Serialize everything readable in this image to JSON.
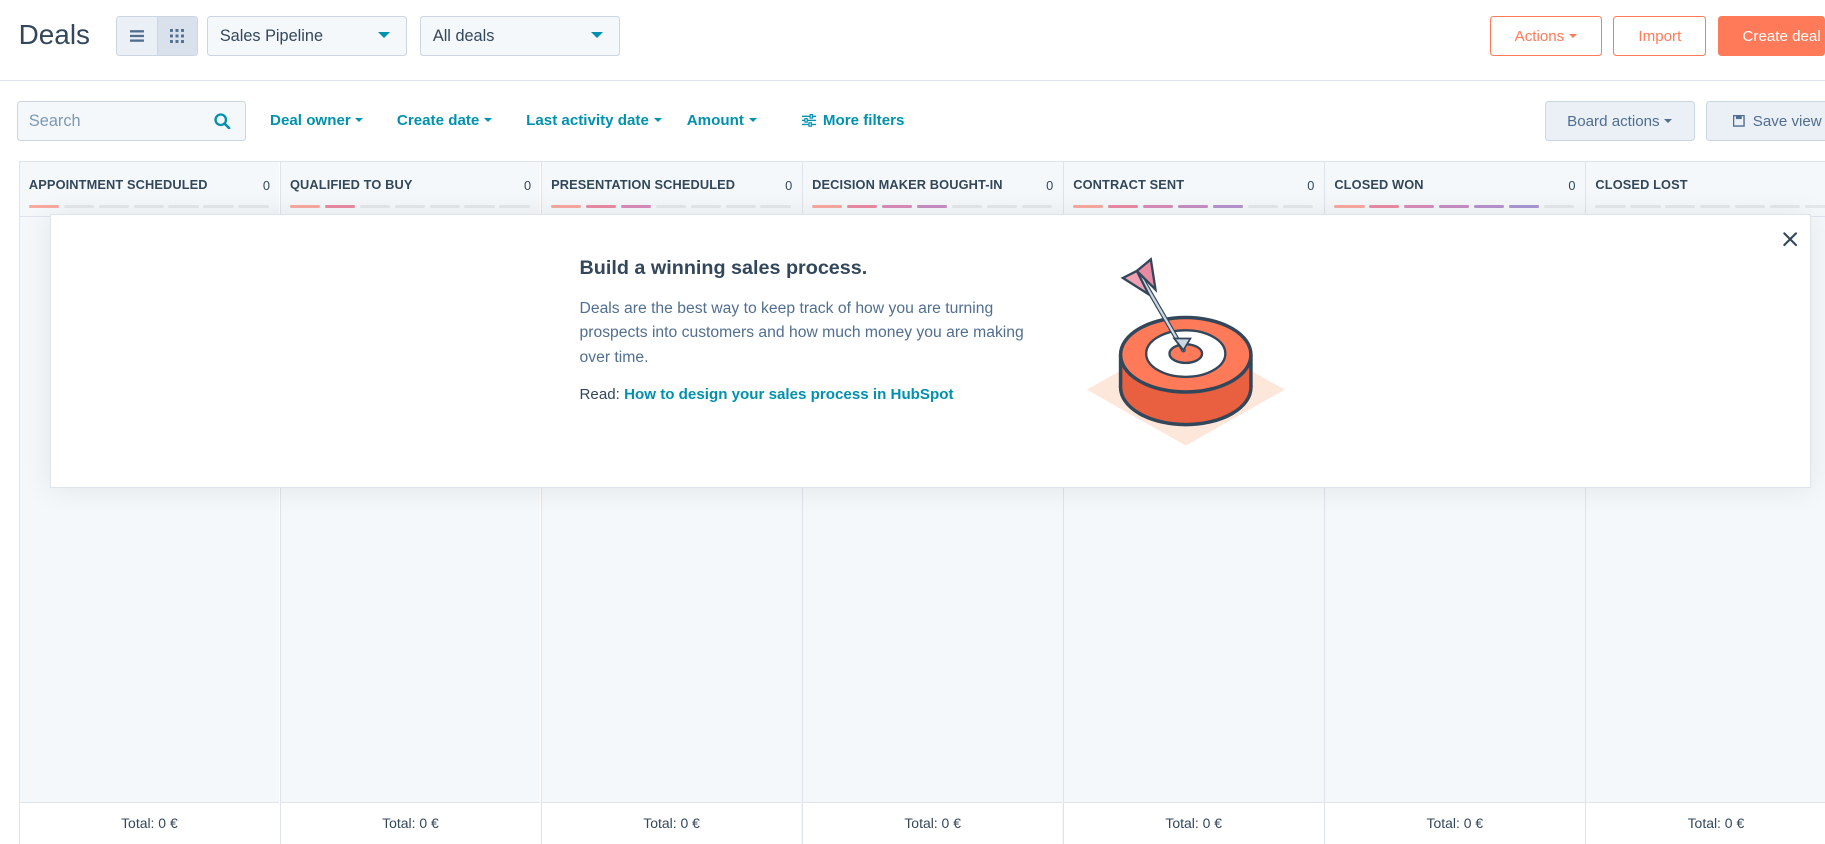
{
  "header": {
    "title": "Deals",
    "pipeline_select": "Sales Pipeline",
    "view_select": "All deals",
    "actions_label": "Actions",
    "import_label": "Import",
    "create_label": "Create deal"
  },
  "filters": {
    "search_placeholder": "Search",
    "deal_owner": "Deal owner",
    "create_date": "Create date",
    "last_activity": "Last activity date",
    "amount": "Amount",
    "more_filters": "More filters",
    "board_actions": "Board actions",
    "save_view": "Save view"
  },
  "columns": [
    {
      "name": "APPOINTMENT SCHEDULED",
      "count": "0",
      "total": "Total: 0 €"
    },
    {
      "name": "QUALIFIED TO BUY",
      "count": "0",
      "total": "Total: 0 €"
    },
    {
      "name": "PRESENTATION SCHEDULED",
      "count": "0",
      "total": "Total: 0 €"
    },
    {
      "name": "DECISION MAKER BOUGHT-IN",
      "count": "0",
      "total": "Total: 0 €"
    },
    {
      "name": "CONTRACT SENT",
      "count": "0",
      "total": "Total: 0 €"
    },
    {
      "name": "CLOSED WON",
      "count": "0",
      "total": "Total: 0 €"
    },
    {
      "name": "CLOSED LOST",
      "count": "",
      "total": "Total: 0 €"
    }
  ],
  "onboarding": {
    "title": "Build a winning sales process.",
    "body": "Deals are the best way to keep track of how you are turning prospects into customers and how much money you are making over time.",
    "read_prefix": "Read:",
    "read_link": "How to design your sales process in HubSpot"
  },
  "colors": {
    "accent": "#ff7a59",
    "link": "#0091ae",
    "stage_bar_1": "#f8a9a0",
    "stage_bar_2": "#e98aa3",
    "stage_bar_3": "#d98bb8",
    "stage_bar_4": "#c68dc3",
    "stage_bar_5": "#b692cc",
    "stage_bar_6": "#a796d3"
  },
  "icons": {
    "list_view": "list-icon",
    "board_view": "grid-icon",
    "search": "search-icon",
    "filters": "sliders-icon",
    "save": "floppy-disk-icon",
    "close": "close-icon",
    "illustration": "target-dart-icon"
  }
}
